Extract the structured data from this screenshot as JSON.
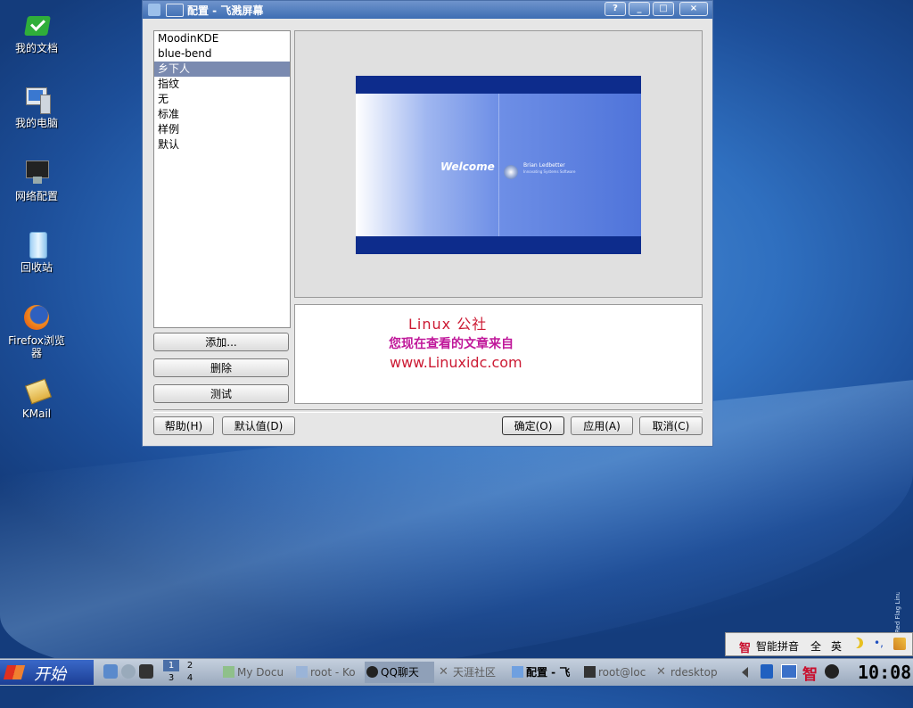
{
  "desktop": {
    "icons": [
      {
        "label": "我的文档",
        "icon": "folder-check-icon"
      },
      {
        "label": "我的电脑",
        "icon": "computer-icon"
      },
      {
        "label": "网络配置",
        "icon": "network-config-icon"
      },
      {
        "label": "回收站",
        "icon": "trash-icon"
      },
      {
        "label": "Firefox浏览器",
        "icon": "firefox-icon"
      },
      {
        "label": "KMail",
        "icon": "kmail-icon"
      }
    ]
  },
  "window": {
    "title": "配置 - 飞溅屏幕",
    "buttons": [
      "?",
      "_",
      "□",
      "×"
    ],
    "themes": [
      "MoodinKDE",
      "blue-bend",
      "乡下人",
      "指纹",
      "无",
      "标准",
      "样例",
      "默认"
    ],
    "selected_theme": "乡下人",
    "add_button": "添加...",
    "remove_button": "删除",
    "test_button": "测试",
    "help_button": "帮助(H)",
    "defaults_button": "默认值(D)",
    "ok_button": "确定(O)",
    "apply_button": "应用(A)",
    "cancel_button": "取消(C)",
    "preview": {
      "welcome": "Welcome",
      "brand_line1": "Brian Ledbetter",
      "brand_line2": "Innovating Systems Software"
    },
    "info": {
      "line1": "Linux 公社",
      "line2": "您现在查看的文章来自",
      "line3": "www.Linuxidc.com"
    }
  },
  "ime_bar": {
    "logo": "智",
    "name": "智能拼音",
    "full": "全",
    "lang": "英"
  },
  "watermark": "Red Flag Linux",
  "taskbar": {
    "start_label": "开始",
    "pager": [
      "1",
      "2",
      "3",
      "4"
    ],
    "tasks": [
      {
        "label": "My Docu",
        "active": false
      },
      {
        "label": "root - Ko",
        "active": false
      },
      {
        "label": "QQ聊天",
        "active": true
      },
      {
        "label": "天涯社区",
        "active": false
      },
      {
        "label": "配置 - 飞",
        "active": false
      },
      {
        "label": "root@loc",
        "active": false
      },
      {
        "label": "rdesktop",
        "active": false
      }
    ],
    "tray_logo": "智",
    "clock": "10:08"
  },
  "colors": {
    "accent": "#3d6db3",
    "selection": "#7a8ab0",
    "info_red": "#cc1a33",
    "info_magenta": "#c0189a"
  }
}
